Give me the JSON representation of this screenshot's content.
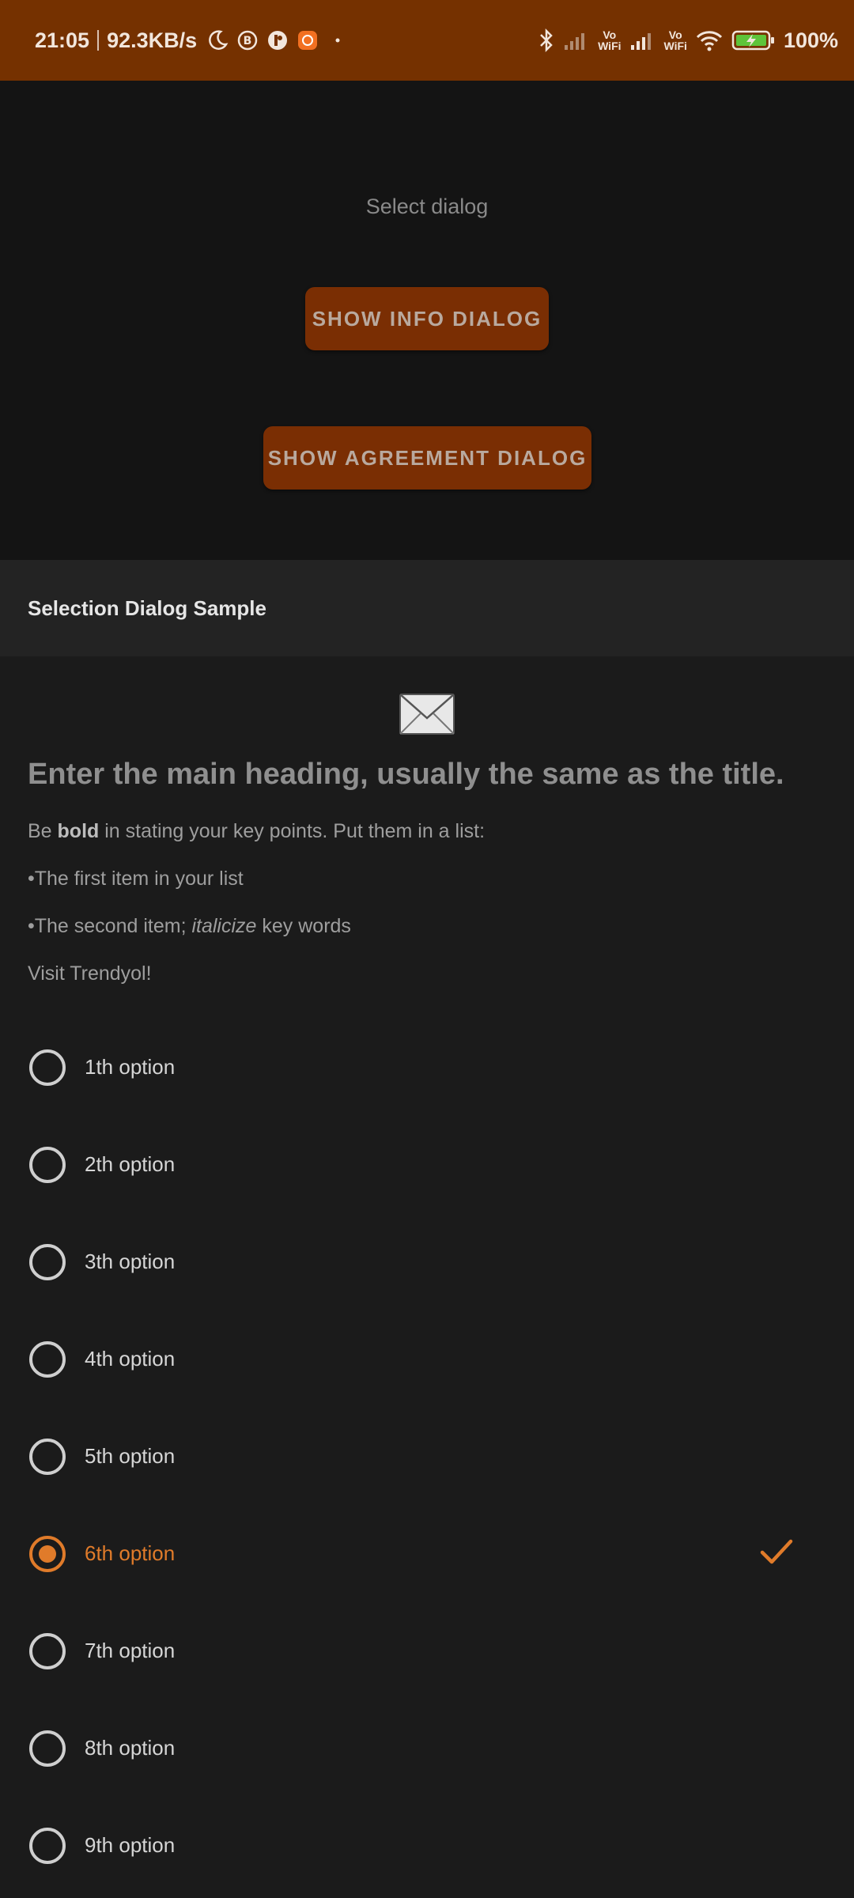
{
  "status_bar": {
    "time": "21:05",
    "speed": "92.3KB/s",
    "battery": "100%",
    "vo_label": "Vo",
    "wifi_label": "WiFi"
  },
  "top": {
    "title": "Select dialog",
    "info_button": "SHOW INFO DIALOG",
    "agreement_button": "SHOW AGREEMENT DIALOG"
  },
  "dialog": {
    "title": "Selection Dialog Sample",
    "heading": "Enter the main heading, usually the same as the title.",
    "para1_before": "Be ",
    "para1_bold": "bold",
    "para1_after": " in stating your key points. Put them in a list:",
    "item1": "•The first item in your list",
    "item2_before": "•The second item; ",
    "item2_italic": "italicize",
    "item2_after": " key words",
    "visit": "Visit Trendyol!"
  },
  "options": [
    {
      "label": "1th option",
      "selected": false
    },
    {
      "label": "2th option",
      "selected": false
    },
    {
      "label": "3th option",
      "selected": false
    },
    {
      "label": "4th option",
      "selected": false
    },
    {
      "label": "5th option",
      "selected": false
    },
    {
      "label": "6th option",
      "selected": true
    },
    {
      "label": "7th option",
      "selected": false
    },
    {
      "label": "8th option",
      "selected": false
    },
    {
      "label": "9th option",
      "selected": false
    }
  ],
  "colors": {
    "accent": "#e07b2a",
    "status_bar": "#753100",
    "button_bg": "#7a2e03",
    "background": "#1b1b1b"
  },
  "icons": [
    "moon-icon",
    "b-circle-icon",
    "p-circle-icon",
    "app-notification-icon",
    "bluetooth-icon",
    "signal-icon",
    "wifi-icon",
    "battery-icon",
    "mail-icon",
    "check-icon"
  ]
}
